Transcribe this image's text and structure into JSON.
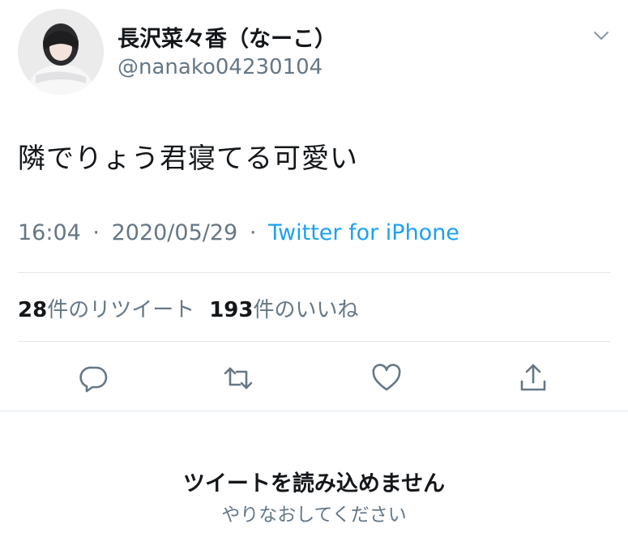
{
  "tweet": {
    "display_name": "長沢菜々香（なーこ）",
    "handle": "@nanako04230104",
    "text": "隣でりょう君寝てる可愛い",
    "time": "16:04",
    "date": "2020/05/29",
    "separator": "·",
    "source": "Twitter for iPhone",
    "retweet_count": "28",
    "retweet_label": "件のリツイート",
    "like_count": "193",
    "like_label": "件のいいね"
  },
  "actions": {
    "icons": [
      "reply-icon",
      "retweet-icon",
      "like-icon",
      "share-icon"
    ]
  },
  "error": {
    "title": "ツイートを読み込めません",
    "retry": "やりなおしてください"
  },
  "colors": {
    "text": "#14171a",
    "secondary": "#657786",
    "link": "#1da1f2",
    "divider": "#e1e8ed"
  }
}
